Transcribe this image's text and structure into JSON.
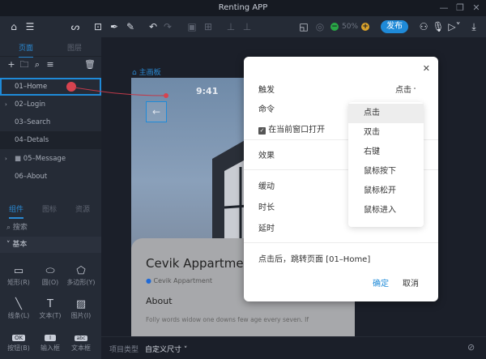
{
  "window": {
    "title": "Renting APP",
    "minimize": "—",
    "restore": "❐",
    "close": "✕"
  },
  "toolbar": {
    "zoom": "50%",
    "zoom_out": "−",
    "zoom_in": "+",
    "publish": "发布"
  },
  "left_panel": {
    "tabs": [
      "页面",
      "图层"
    ],
    "pages": [
      "01–Home",
      "02–Login",
      "03–Search",
      "04–Detals",
      "05–Message",
      "06–About"
    ],
    "comp_tabs": [
      "组件",
      "图标",
      "资源"
    ],
    "search_placeholder": "搜索",
    "section": "基本",
    "components": [
      {
        "label": "矩形(R)",
        "icon": "rectangle-icon"
      },
      {
        "label": "圆(O)",
        "icon": "ellipse-icon"
      },
      {
        "label": "多边形(Y)",
        "icon": "polygon-icon"
      },
      {
        "label": "线条(L)",
        "icon": "line-icon"
      },
      {
        "label": "文本(T)",
        "icon": "text-icon"
      },
      {
        "label": "图片(I)",
        "icon": "image-icon"
      },
      {
        "label": "按钮(B)",
        "icon": "button-icon",
        "glyph": "OK"
      },
      {
        "label": "输入框",
        "icon": "input-icon",
        "glyph": "I"
      },
      {
        "label": "文本框",
        "icon": "textarea-icon",
        "glyph": "abc"
      }
    ]
  },
  "canvas": {
    "board_label": "主画板",
    "time": "9:41",
    "title": "Cevik Appartment",
    "location": "Cevik Appartment",
    "about": "About",
    "body": "Folly words widow one downs few age every seven. If"
  },
  "modal": {
    "trigger_label": "触发",
    "trigger_value": "点击",
    "command_label": "命令",
    "open_current": "在当前窗口打开",
    "effect_label": "效果",
    "easing_label": "缓动",
    "duration_label": "时长",
    "delay_label": "延时",
    "summary": "点击后，跳转页面 [01–Home]",
    "confirm": "确定",
    "cancel": "取消",
    "close": "✕",
    "options": [
      "点击",
      "双击",
      "右键",
      "鼠标按下",
      "鼠标松开",
      "鼠标进入"
    ]
  },
  "bottom": {
    "project_type_label": "项目类型",
    "project_type_value": "自定义尺寸"
  },
  "colors": {
    "accent": "#1f8ad8",
    "panel": "#252b36",
    "canvas": "#1b1f29"
  }
}
